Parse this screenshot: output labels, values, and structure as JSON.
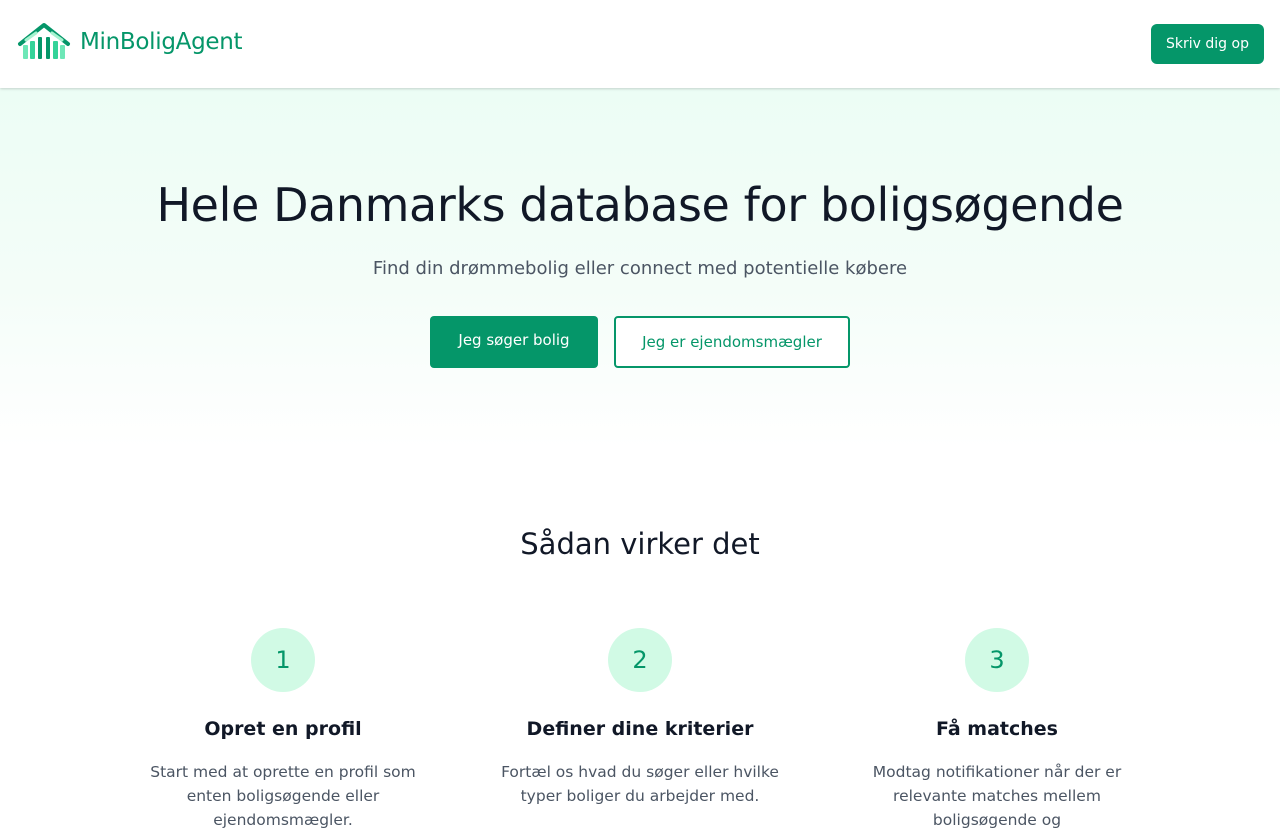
{
  "header": {
    "brand": "MinBoligAgent",
    "logo_icon": "house-logo-icon",
    "signup_label": "Skriv dig op"
  },
  "hero": {
    "title": "Hele Danmarks database for boligsøgende",
    "subtitle": "Find din drømmebolig eller connect med potentielle købere",
    "primary_cta": "Jeg søger bolig",
    "secondary_cta": "Jeg er ejendomsmægler"
  },
  "how_it_works": {
    "title": "Sådan virker det",
    "steps": [
      {
        "number": "1",
        "title": "Opret en profil",
        "description": "Start med at oprette en profil som enten boligsøgende eller ejendomsmægler."
      },
      {
        "number": "2",
        "title": "Definer dine kriterier",
        "description": "Fortæl os hvad du søger eller hvilke typer boliger du arbejder med."
      },
      {
        "number": "3",
        "title": "Få matches",
        "description": "Modtag notifikationer når der er relevante matches mellem boligsøgende og"
      }
    ]
  },
  "colors": {
    "brand_green": "#059669",
    "circle_bg": "#d1fae5",
    "hero_bg": "#ecfdf5"
  }
}
